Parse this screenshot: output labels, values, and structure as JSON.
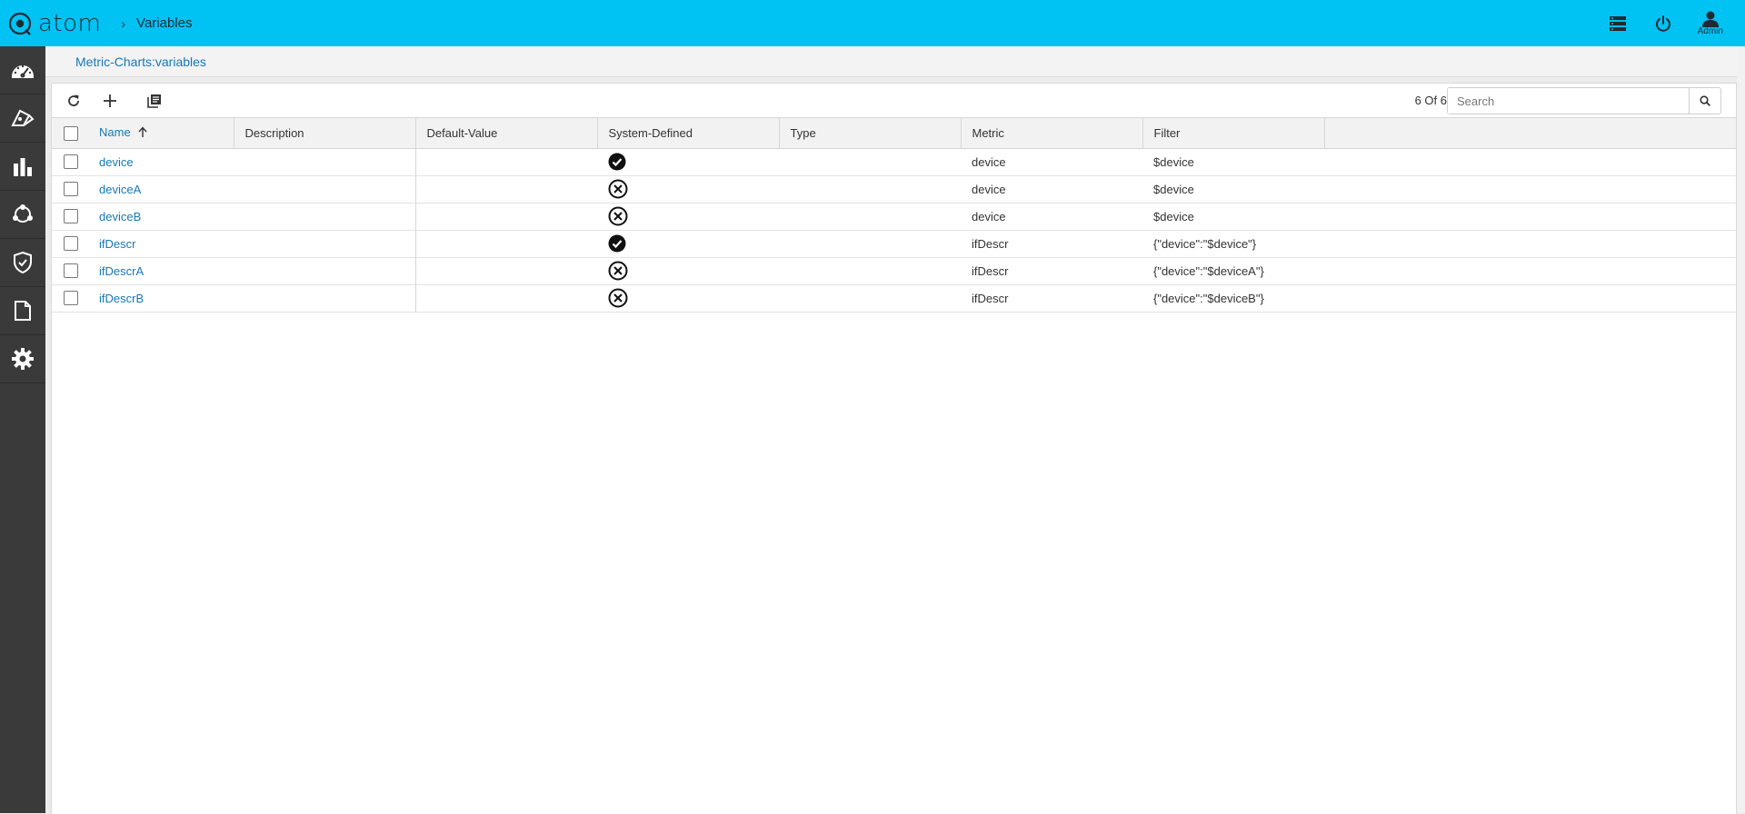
{
  "app": {
    "logo_text": "atom",
    "breadcrumb_sep": "›",
    "breadcrumb_page": "Variables"
  },
  "header": {
    "admin_label": "Admin"
  },
  "page": {
    "breadcrumb_link": "Metric-Charts:variables"
  },
  "toolbar": {
    "count_text": "6 Of 6",
    "search_placeholder": "Search"
  },
  "table": {
    "columns": [
      "Name",
      "Description",
      "Default-Value",
      "System-Defined",
      "Type",
      "Metric",
      "Filter"
    ],
    "rows": [
      {
        "name": "device",
        "description": "",
        "default_value": "",
        "system_defined": "check",
        "type": "",
        "metric": "device",
        "filter": "$device"
      },
      {
        "name": "deviceA",
        "description": "",
        "default_value": "",
        "system_defined": "cross",
        "type": "",
        "metric": "device",
        "filter": "$device"
      },
      {
        "name": "deviceB",
        "description": "",
        "default_value": "",
        "system_defined": "cross",
        "type": "",
        "metric": "device",
        "filter": "$device"
      },
      {
        "name": "ifDescr",
        "description": "",
        "default_value": "",
        "system_defined": "check",
        "type": "",
        "metric": "ifDescr",
        "filter": "{\"device\":\"$device\"}"
      },
      {
        "name": "ifDescrA",
        "description": "",
        "default_value": "",
        "system_defined": "cross",
        "type": "",
        "metric": "ifDescr",
        "filter": "{\"device\":\"$deviceA\"}"
      },
      {
        "name": "ifDescrB",
        "description": "",
        "default_value": "",
        "system_defined": "cross",
        "type": "",
        "metric": "ifDescr",
        "filter": "{\"device\":\"$deviceB\"}"
      }
    ]
  },
  "icons": {
    "sidebar": [
      "dashboard-icon",
      "devices-icon",
      "charts-icon",
      "topology-icon",
      "security-icon",
      "documents-icon",
      "settings-icon"
    ],
    "header": [
      "list-icon",
      "power-icon",
      "user-icon"
    ],
    "toolbar": [
      "refresh-icon",
      "add-icon",
      "library-icon"
    ]
  },
  "colors": {
    "topbar": "#00c2f3",
    "sidebar": "#3a3a3a",
    "link": "#1578b8"
  }
}
